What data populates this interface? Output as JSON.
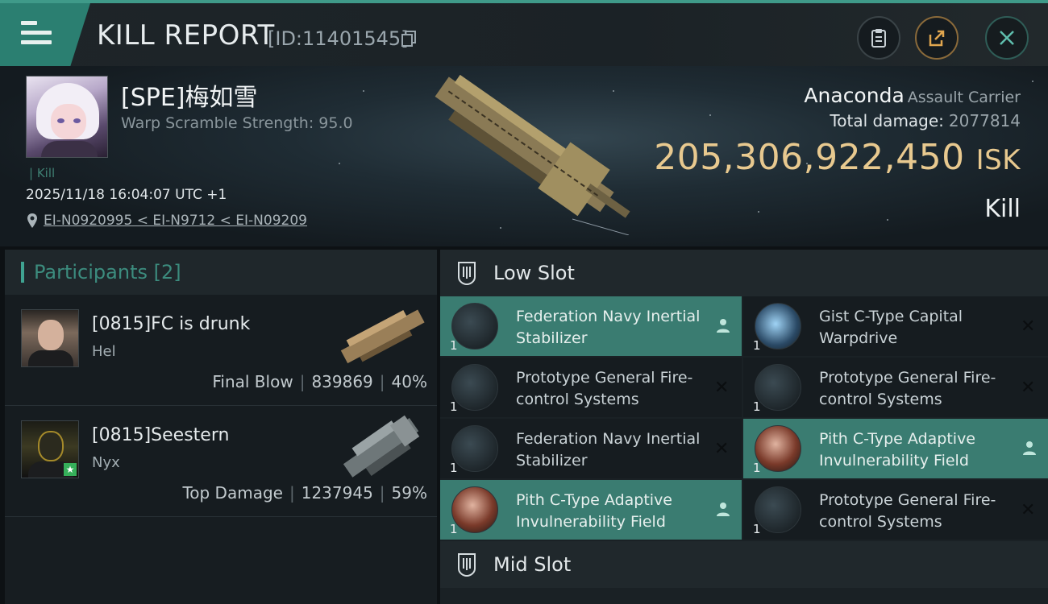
{
  "header": {
    "title": "KILL REPORT",
    "report_id": "[ID:11401545]",
    "icons": {
      "menu": "menu-icon",
      "copy": "copy-icon",
      "clipboard": "clipboard-icon",
      "share": "share-icon",
      "close": "close-icon"
    }
  },
  "victim": {
    "name": "[SPE]梅如雪",
    "warp_scramble": "Warp Scramble Strength: 95.0",
    "tag": "Kill",
    "datetime": "2025/11/18 16:04:07 UTC +1",
    "location": "EI-N0920995 < EI-N9712 < EI-N09209",
    "ship_name": "Anaconda",
    "ship_class": "Assault Carrier",
    "total_damage_label": "Total damage:",
    "total_damage": "2077814",
    "isk_value": "205,306,922,450",
    "isk_currency": "ISK",
    "result": "Kill"
  },
  "participants": {
    "header": "Participants [2]",
    "list": [
      {
        "name": "[0815]FC is drunk",
        "ship": "Hel",
        "role": "Final Blow",
        "damage": "839869",
        "percent": "40%"
      },
      {
        "name": "[0815]Seestern",
        "ship": "Nyx",
        "role": "Top Damage",
        "damage": "1237945",
        "percent": "59%"
      }
    ]
  },
  "slots": {
    "low_slot_label": "Low Slot",
    "mid_slot_label": "Mid Slot",
    "low_items": [
      {
        "name": "Federation Navy Inertial Stabilizer",
        "qty": "1",
        "status": "fleet"
      },
      {
        "name": "Gist C-Type Capital Warpdrive",
        "qty": "1",
        "status": "destroyed"
      },
      {
        "name": "Prototype General Fire-control Systems",
        "qty": "1",
        "status": "destroyed"
      },
      {
        "name": "Prototype General Fire-control Systems",
        "qty": "1",
        "status": "destroyed"
      },
      {
        "name": "Federation Navy Inertial Stabilizer",
        "qty": "1",
        "status": "destroyed"
      },
      {
        "name": "Pith C-Type Adaptive Invulnerability Field",
        "qty": "1",
        "status": "fleet"
      },
      {
        "name": "Pith C-Type Adaptive Invulnerability Field",
        "qty": "1",
        "status": "fleet"
      },
      {
        "name": "Prototype General Fire-control Systems",
        "qty": "1",
        "status": "destroyed"
      }
    ]
  },
  "colors": {
    "accent": "#3a7c71",
    "isk": "#e8c98f",
    "participants_header": "#3c8c7e"
  }
}
